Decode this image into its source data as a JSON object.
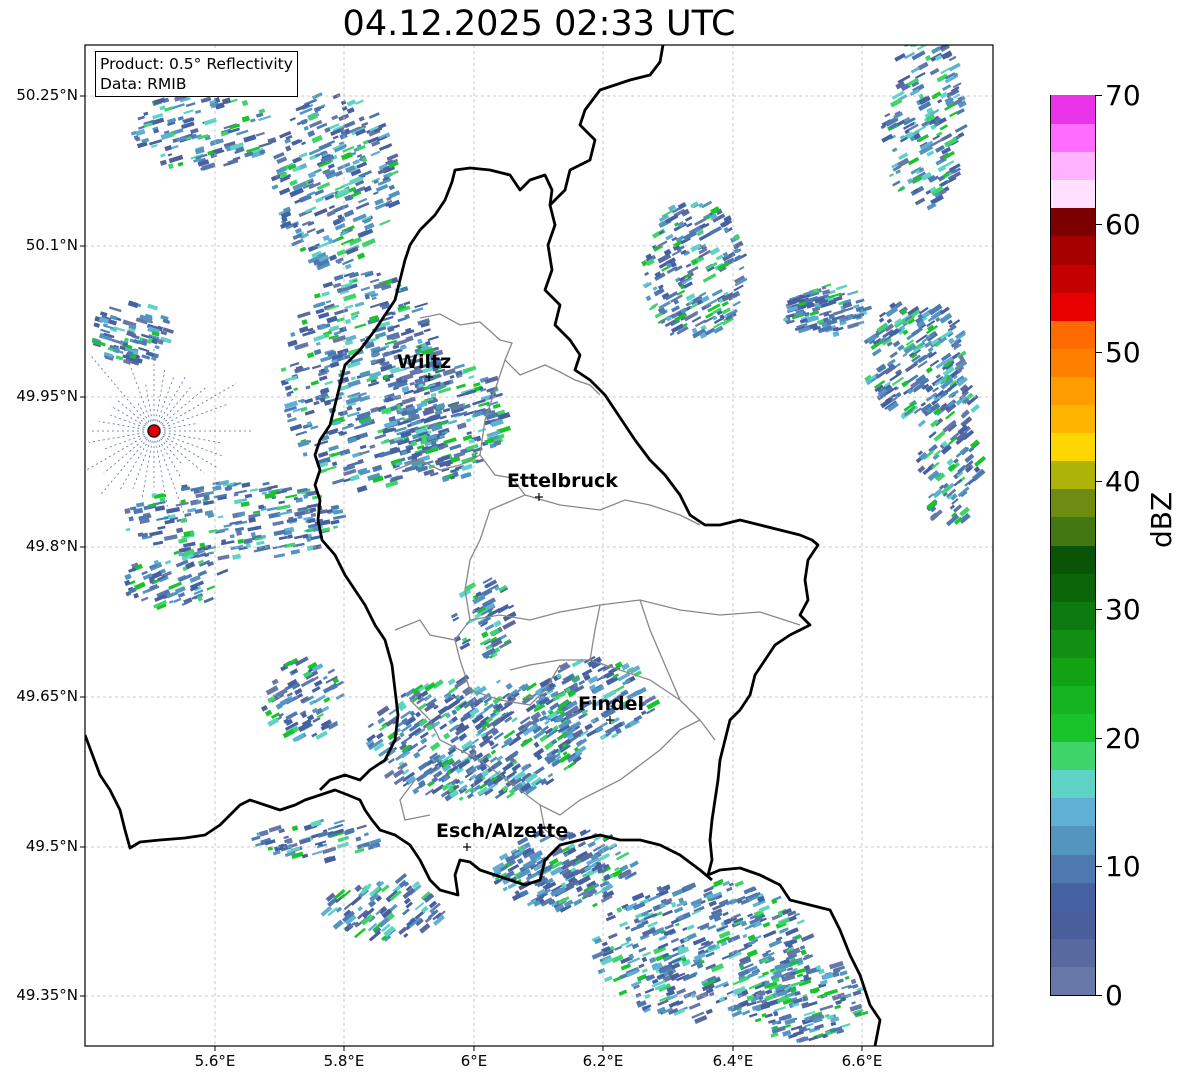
{
  "title": "04.12.2025 02:33 UTC",
  "info": {
    "product": "Product: 0.5° Reflectivity",
    "data": "Data: RMIB"
  },
  "lat_labels": [
    "50.25°N",
    "50.1°N",
    "49.95°N",
    "49.8°N",
    "49.65°N",
    "49.5°N",
    "49.35°N"
  ],
  "lon_labels": [
    "5.6°E",
    "5.8°E",
    "6°E",
    "6.2°E",
    "6.4°E",
    "6.6°E"
  ],
  "cities": [
    {
      "name": "Wiltz"
    },
    {
      "name": "Ettelbruck"
    },
    {
      "name": "Findel"
    },
    {
      "name": "Esch/Alzette"
    }
  ],
  "colorbar": {
    "unit": "dBZ",
    "min": 0,
    "max": 70,
    "tick_labels": [
      "0",
      "10",
      "20",
      "30",
      "40",
      "50",
      "60",
      "70"
    ],
    "colors": [
      "#6677a8",
      "#58699f",
      "#4a5e9c",
      "#4561a2",
      "#4d78b0",
      "#5495c0",
      "#5fb0d4",
      "#5fd4c6",
      "#3fd46a",
      "#19c42a",
      "#14b520",
      "#12a315",
      "#108f12",
      "#0c7a0e",
      "#0a6609",
      "#0a5408",
      "#437712",
      "#6f8c12",
      "#aeb30a",
      "#ffd600",
      "#ffb500",
      "#ff9c00",
      "#ff8000",
      "#ff6a00",
      "#e80000",
      "#c40000",
      "#a60000",
      "#7d0000",
      "#ffe0ff",
      "#ffb3ff",
      "#ff6cff",
      "#e833e8"
    ]
  },
  "colors": {
    "border": "#000000",
    "province": "#888888",
    "grid": "#bbbbbb",
    "radar_site": "#dd0000"
  }
}
